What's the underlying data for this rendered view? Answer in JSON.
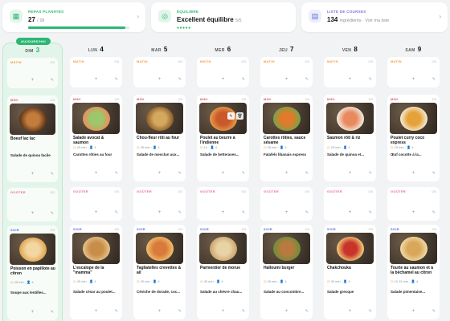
{
  "summary": {
    "planned": {
      "title": "REPAS PLANIFIÉS",
      "value": "27",
      "total": "/ 28",
      "progress": 0.964,
      "icon": "calendar-icon"
    },
    "balance": {
      "title": "ÉQUILIBRE",
      "value": "Excellent équilibre",
      "score": "5/5",
      "rating": 5,
      "icon": "target-icon"
    },
    "shopping": {
      "title": "LISTE DE COURSES",
      "value": "134",
      "suffix": "ingrédients · Voir ma liste",
      "icon": "cart-icon"
    }
  },
  "today_badge": "AUJOURD'HUI",
  "slot_labels": {
    "matin": "MATIN",
    "midi": "MIDI",
    "gouter": "GOÛTER",
    "soir": "SOIR"
  },
  "slot_counts": {
    "matin": "0/3",
    "midi": "2/3",
    "gouter": "0/3",
    "soir": "2/3"
  },
  "days": [
    {
      "dow": "DIM",
      "num": "3",
      "midi": {
        "name": "Boeuf lac lac",
        "time": "",
        "kcal": "",
        "side": "Salade de quinoa facile",
        "img": "beef"
      },
      "soir": {
        "name": "Poisson en papillote au citron",
        "time": "25 min",
        "kcal": "4",
        "side": "Soupe aux lentilles...",
        "img": "fish"
      }
    },
    {
      "dow": "LUN",
      "num": "4",
      "midi": {
        "name": "Salade avocat & saumon",
        "time": "25 min",
        "kcal": "4",
        "side": "Carottes rôties au four",
        "img": "salad"
      },
      "soir": {
        "name": "L'escalope de la \"mamma\"",
        "time": "40 min",
        "kcal": "4",
        "side": "Salade césar au poulet...",
        "img": "escalope"
      }
    },
    {
      "dow": "MAR",
      "num": "5",
      "midi": {
        "name": "Chou-fleur rôti au four",
        "time": "25 min",
        "kcal": "4",
        "side": "Salade de mesclun aux...",
        "img": "cauli"
      },
      "soir": {
        "name": "Tagliatelles crevettes & ail",
        "time": "20 min",
        "kcal": "4",
        "side": "Céviche de dorade, coc...",
        "img": "pasta"
      }
    },
    {
      "dow": "MER",
      "num": "6",
      "midi": {
        "name": "Poulet au beurre à l'indienne",
        "time": "1h",
        "kcal": "4",
        "side": "Salade de betteraves...",
        "img": "butter"
      },
      "soir": {
        "name": "Parmentier de morue",
        "time": "45 min",
        "kcal": "4",
        "side": "Salade au chèvre chau...",
        "img": "parm"
      }
    },
    {
      "dow": "JEU",
      "num": "7",
      "midi": {
        "name": "Carottes rôties, sauce sésame",
        "time": "35 min",
        "kcal": "4",
        "side": "Falafels libanais express",
        "img": "carrot"
      },
      "soir": {
        "name": "Halloumi burger",
        "time": "40 min",
        "kcal": "4",
        "side": "Salade au concombre...",
        "img": "burger"
      }
    },
    {
      "dow": "VEN",
      "num": "8",
      "midi": {
        "name": "Saumon rôti & riz",
        "time": "25 min",
        "kcal": "4",
        "side": "Salade de quinoa et...",
        "img": "salmon"
      },
      "soir": {
        "name": "Chakchouka",
        "time": "40 min",
        "kcal": "4",
        "side": "Salade grecque",
        "img": "shak"
      }
    },
    {
      "dow": "SAM",
      "num": "9",
      "midi": {
        "name": "Poulet curry coco express",
        "time": "25 min",
        "kcal": "4",
        "side": "Œuf cocotte à la...",
        "img": "curry"
      },
      "soir": {
        "name": "Tourte au saumon et à la béchamel au citron",
        "time": "1h 15 min",
        "kcal": "4",
        "side": "Salade pimentaise...",
        "img": "pie"
      }
    }
  ],
  "colors": {
    "accent": "#2bb673",
    "matin": "#f39a3c",
    "midi": "#e0556b",
    "gouter": "#e86aa0",
    "soir": "#5b6fe0"
  }
}
